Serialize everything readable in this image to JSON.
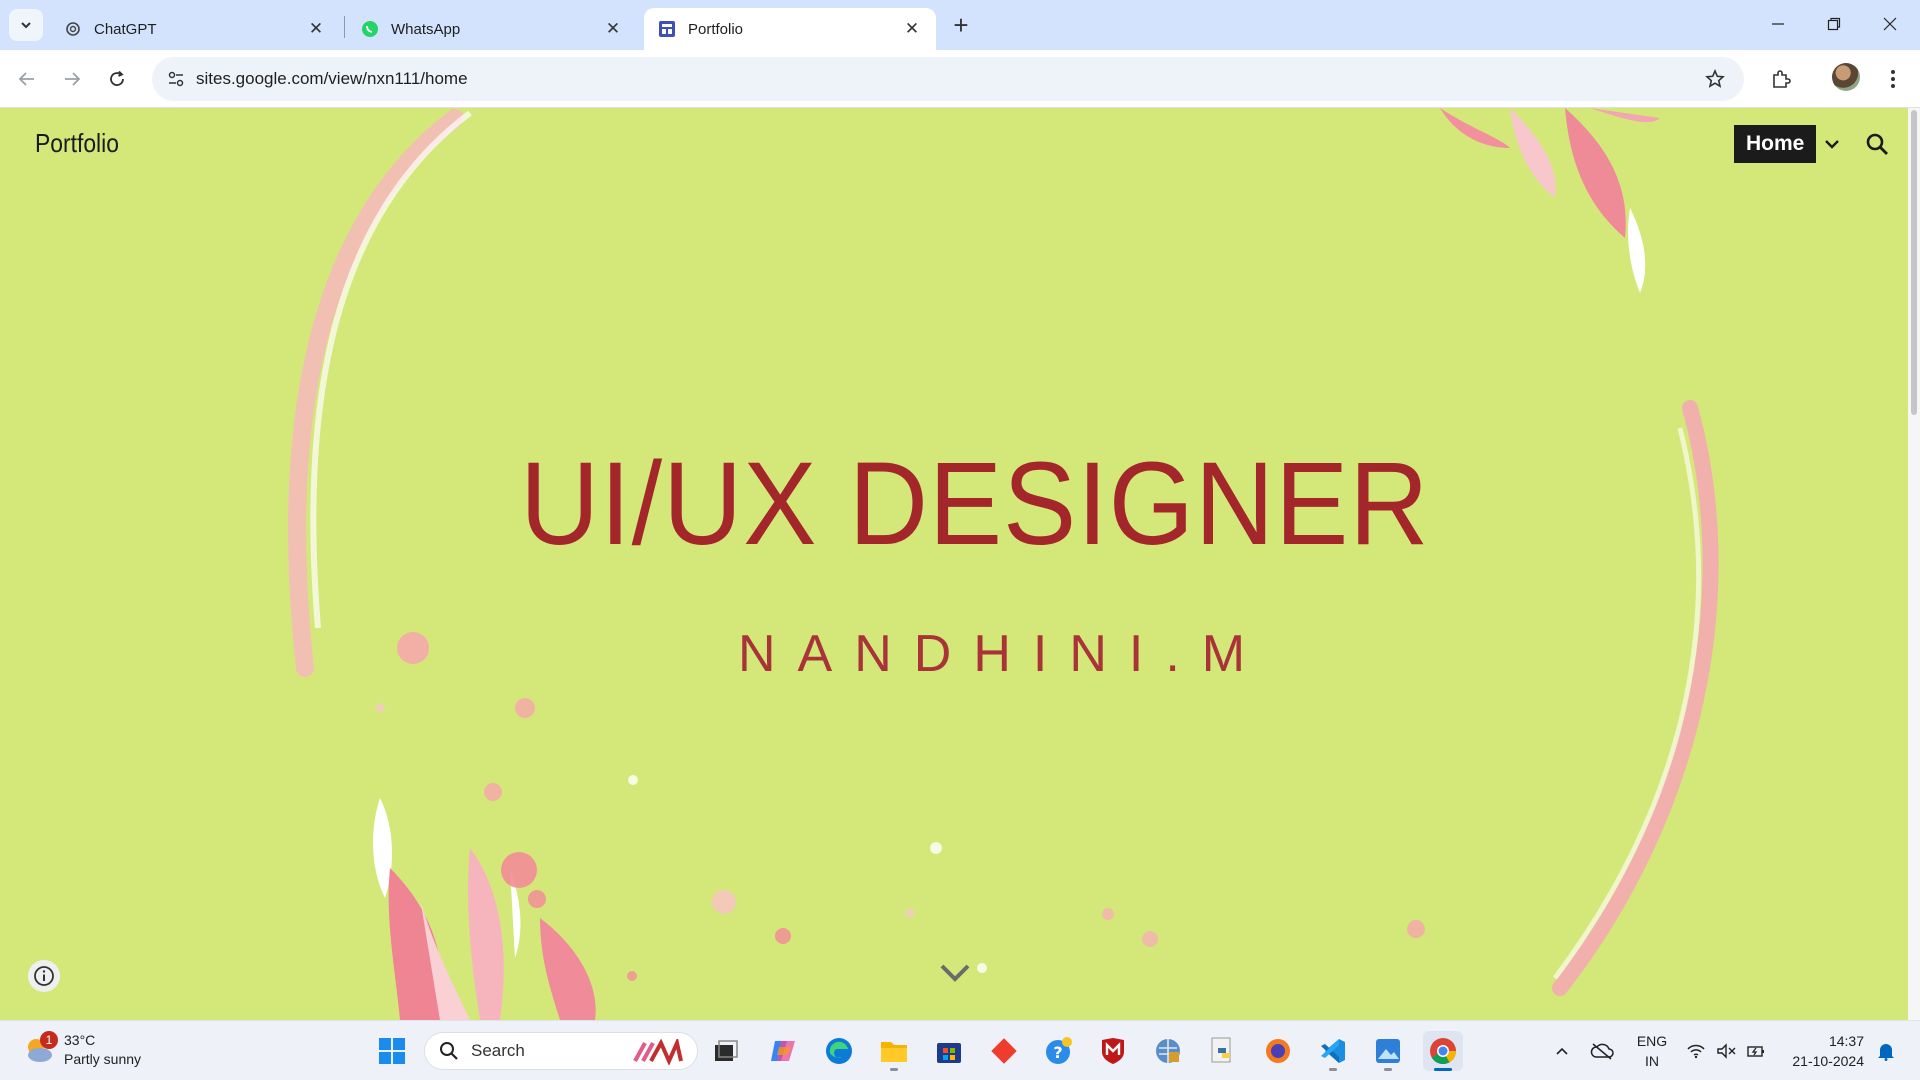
{
  "browser": {
    "tabs": [
      {
        "title": "ChatGPT",
        "icon": "chatgpt-icon"
      },
      {
        "title": "WhatsApp",
        "icon": "whatsapp-icon"
      },
      {
        "title": "Portfolio",
        "icon": "google-sites-icon",
        "active": true
      }
    ],
    "url": "sites.google.com/view/nxn111/home"
  },
  "site": {
    "name": "Portfolio",
    "nav_home": "Home",
    "headline": "UI/UX DESIGNER",
    "subname": "NANDHINI.M",
    "background_color": "#d4e87a",
    "accent_color": "#a3272a"
  },
  "taskbar": {
    "weather": {
      "temp": "33°C",
      "condition": "Partly sunny",
      "badge": "1"
    },
    "search_label": "Search",
    "apps": [
      "windows-start-icon",
      "search-icon",
      "task-view-icon",
      "copilot-icon",
      "edge-icon",
      "file-explorer-icon",
      "store-icon",
      "git-icon",
      "help-icon",
      "mcafee-icon",
      "network-app-icon",
      "python-icon",
      "firefox-icon",
      "vscode-icon",
      "photos-icon",
      "chrome-icon"
    ],
    "lang_top": "ENG",
    "lang_bottom": "IN",
    "time": "14:37",
    "date": "21-10-2024"
  }
}
